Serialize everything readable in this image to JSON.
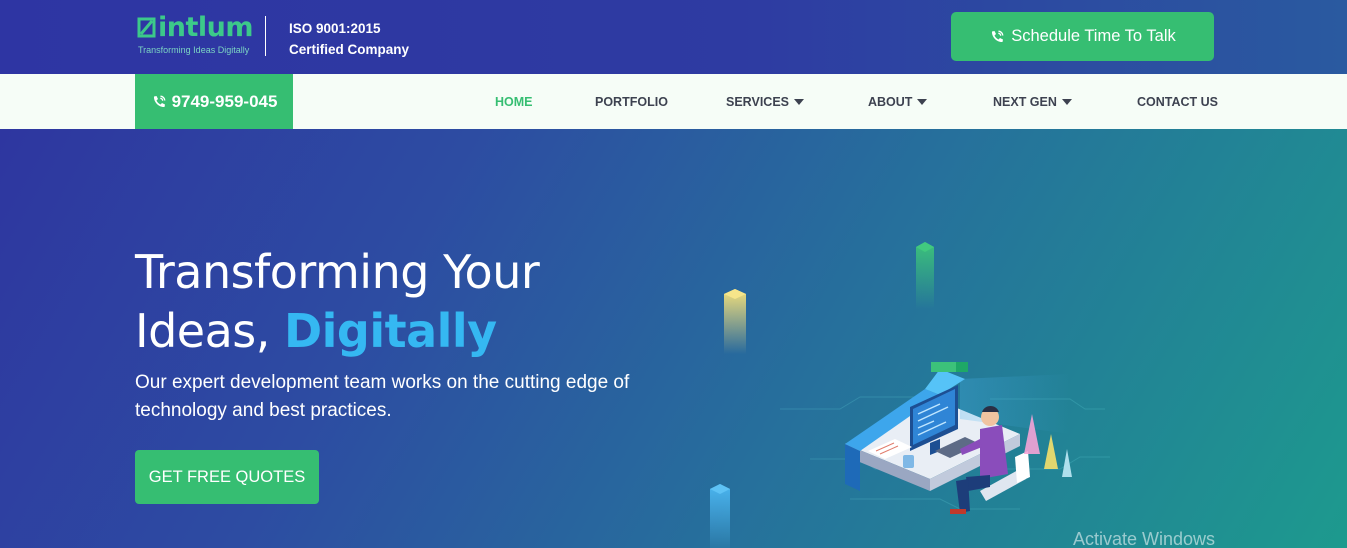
{
  "brand": {
    "logo_text": "intlum",
    "tagline": "Transforming Ideas Digitally",
    "certification_line1": "ISO 9001:2015",
    "certification_line2": "Certified Company"
  },
  "header": {
    "cta_label": "Schedule Time To Talk",
    "phone_number": "9749-959-045"
  },
  "nav": {
    "items": [
      {
        "label": "HOME",
        "active": true,
        "has_dropdown": false
      },
      {
        "label": "PORTFOLIO",
        "active": false,
        "has_dropdown": false
      },
      {
        "label": "SERVICES",
        "active": false,
        "has_dropdown": true
      },
      {
        "label": "ABOUT",
        "active": false,
        "has_dropdown": true
      },
      {
        "label": "NEXT GEN",
        "active": false,
        "has_dropdown": true
      },
      {
        "label": "CONTACT US",
        "active": false,
        "has_dropdown": false
      }
    ]
  },
  "hero": {
    "title_line1": "Transforming Your",
    "title_line2_prefix": "Ideas, ",
    "title_line2_accent": "Digitally",
    "subtitle": "Our expert development team works on the cutting edge of technology and best practices.",
    "button_label": "GET FREE QUOTES"
  },
  "system": {
    "watermark": "Activate Windows"
  },
  "colors": {
    "brand_green": "#36be72",
    "accent_blue": "#35b8f2",
    "nav_background": "#f6fdf7",
    "header_background": "#2e35a3"
  },
  "icons": {
    "phone": "phone-ringing-icon",
    "caret": "caret-down-icon",
    "logo_mark": "logo-square-icon",
    "illustration": "developer-at-desk-illustration"
  }
}
